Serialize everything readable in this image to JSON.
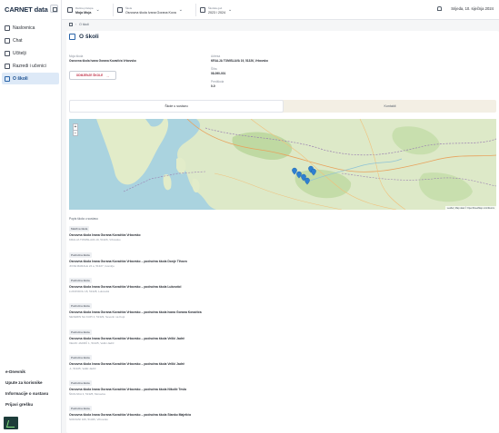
{
  "brand": "CARNET data",
  "sidebar": {
    "items": [
      {
        "label": "Naslovnica",
        "icon": "home-icon"
      },
      {
        "label": "Chat",
        "icon": "chat-icon"
      },
      {
        "label": "Učitelji",
        "icon": "teacher-icon"
      },
      {
        "label": "Razredi i učenici",
        "icon": "classroom-icon"
      },
      {
        "label": "O školi",
        "icon": "school-icon"
      }
    ],
    "bottom_links": [
      "e-Dnevnik",
      "Upute za korisnike",
      "Informacije o sustavu",
      "Prijavi grešku"
    ]
  },
  "topbar": {
    "role_label": "Razina pristupa",
    "role_value": "Moja Moja",
    "school_label": "Škola",
    "school_value": "Osnovna škola Ivana Gorana Kova",
    "year_label": "Školska god.",
    "year_value": "2023 / 2024",
    "date": "Srijeda, 10. siječnja 2024"
  },
  "breadcrumb": {
    "current": "O školi"
  },
  "page": {
    "title": "O školi",
    "school_label": "Moja škola",
    "school_name": "Osnovna škola Ivana Gorana Kovačića Vrbovsko",
    "address_label": "Adresa",
    "address_value": "KRALJA TOMISLAVA 19, 51326, Vrbovsko",
    "code_label": "Šifra",
    "code_value": "08-090-001",
    "misc_label": "Predškola",
    "misc_value": "0-0",
    "more_button": "ODMJENJE ŠKOLE"
  },
  "tabs": [
    "Škole u sustavu",
    "Kontakti"
  ],
  "map": {
    "attribution": "Leaflet | Map data © OpenStreetMap contributors"
  },
  "list": {
    "title": "Popis škola u sustavu",
    "entries": [
      {
        "type": "Matična škola",
        "name": "Osnovna škola Ivana Gorana Kovačića Vrbovsko",
        "address": "KRALJA TOMISLAVA 19, 51326, Vrbovsko"
      },
      {
        "type": "Područna škola",
        "name": "Osnovna škola Ivana Gorana Kovačića Vrbovsko – područna škola Donje Tihovo",
        "address": "JOVE MARALE 24 a, 51327, Gomirje"
      },
      {
        "type": "Područna škola",
        "name": "Osnovna škola Ivana Gorana Kovačića Vrbovsko – područna škola Lukovdol",
        "address": "LUKOVDOL 18, 51328, Lukovdol"
      },
      {
        "type": "Područna škola",
        "name": "Osnovna škola Ivana Gorana Kovačića Vrbovsko – područna škola Ivana Gorana Kovačića",
        "address": "SEVERIN NA KUPI 4, 51329, Severin na Kupi"
      },
      {
        "type": "Područna škola",
        "name": "Osnovna škola Ivana Gorana Kovačića Vrbovsko – područna škola Veliki Jadrč",
        "address": "VELIKI JADRČ 1, 51325, Veliki Jadrč"
      },
      {
        "type": "Područna škola",
        "name": "Osnovna škola Ivana Gorana Kovačića Vrbovsko – područna škola Veliki Jadrč",
        "address": "-1, 51325, Veliki Jadrč"
      },
      {
        "type": "Područna škola",
        "name": "Osnovna škola Ivana Gorana Kovačića Vrbovsko – područna škola Nikolić Tesla",
        "address": "ŠKOLSKA 3, 51325, Moravice"
      },
      {
        "type": "Područna škola",
        "name": "Osnovna škola Ivana Gorana Kovačića Vrbovsko – područna škola Stanko Majetića",
        "address": "SORJANI 106, 51326, Vrbovsko"
      }
    ]
  },
  "colors": {
    "accent": "#2a64a8",
    "danger": "#c2334b",
    "sea": "#aad3df",
    "land": "#d9e8c4"
  }
}
